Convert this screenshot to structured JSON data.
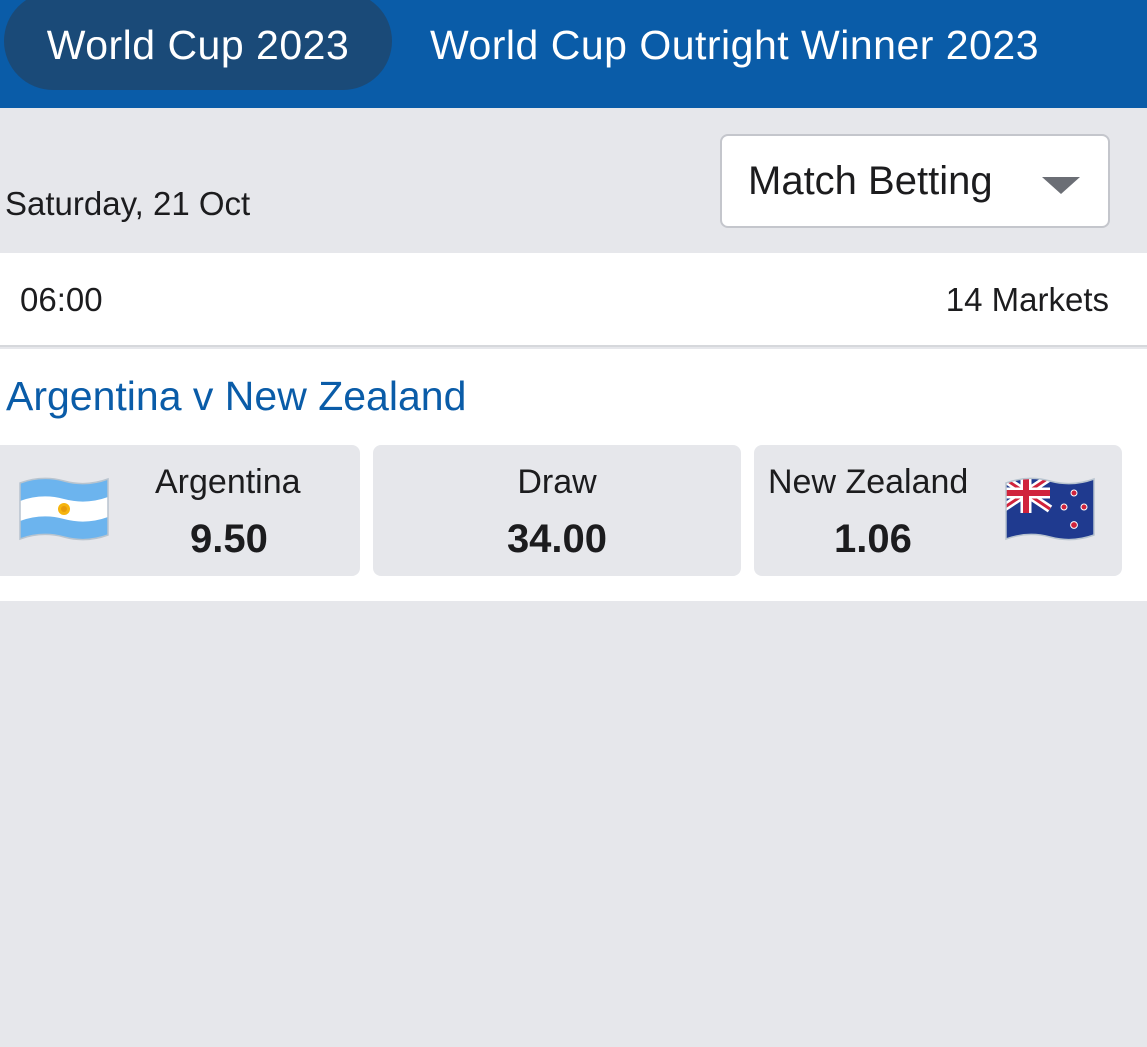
{
  "tabs": [
    {
      "label": "World Cup 2023",
      "active": true
    },
    {
      "label": "World Cup Outright Winner 2023",
      "active": false
    }
  ],
  "filters": {
    "date": "Saturday, 21 Oct",
    "market_select": {
      "selected": "Match Betting"
    }
  },
  "event": {
    "time": "06:00",
    "markets": "14 Markets",
    "title": "Argentina v New Zealand",
    "selections": {
      "home": {
        "name": "Argentina",
        "price": "9.50",
        "flag_icon": "argentina-flag-icon"
      },
      "draw": {
        "name": "Draw",
        "price": "34.00"
      },
      "away": {
        "name": "New Zealand",
        "price": "1.06",
        "flag_icon": "new-zealand-flag-icon"
      }
    }
  },
  "colors": {
    "header_blue": "#0a5ca8",
    "active_tab": "#1a4a78",
    "link_blue": "#0a5ca8",
    "background": "#e6e7eb"
  }
}
